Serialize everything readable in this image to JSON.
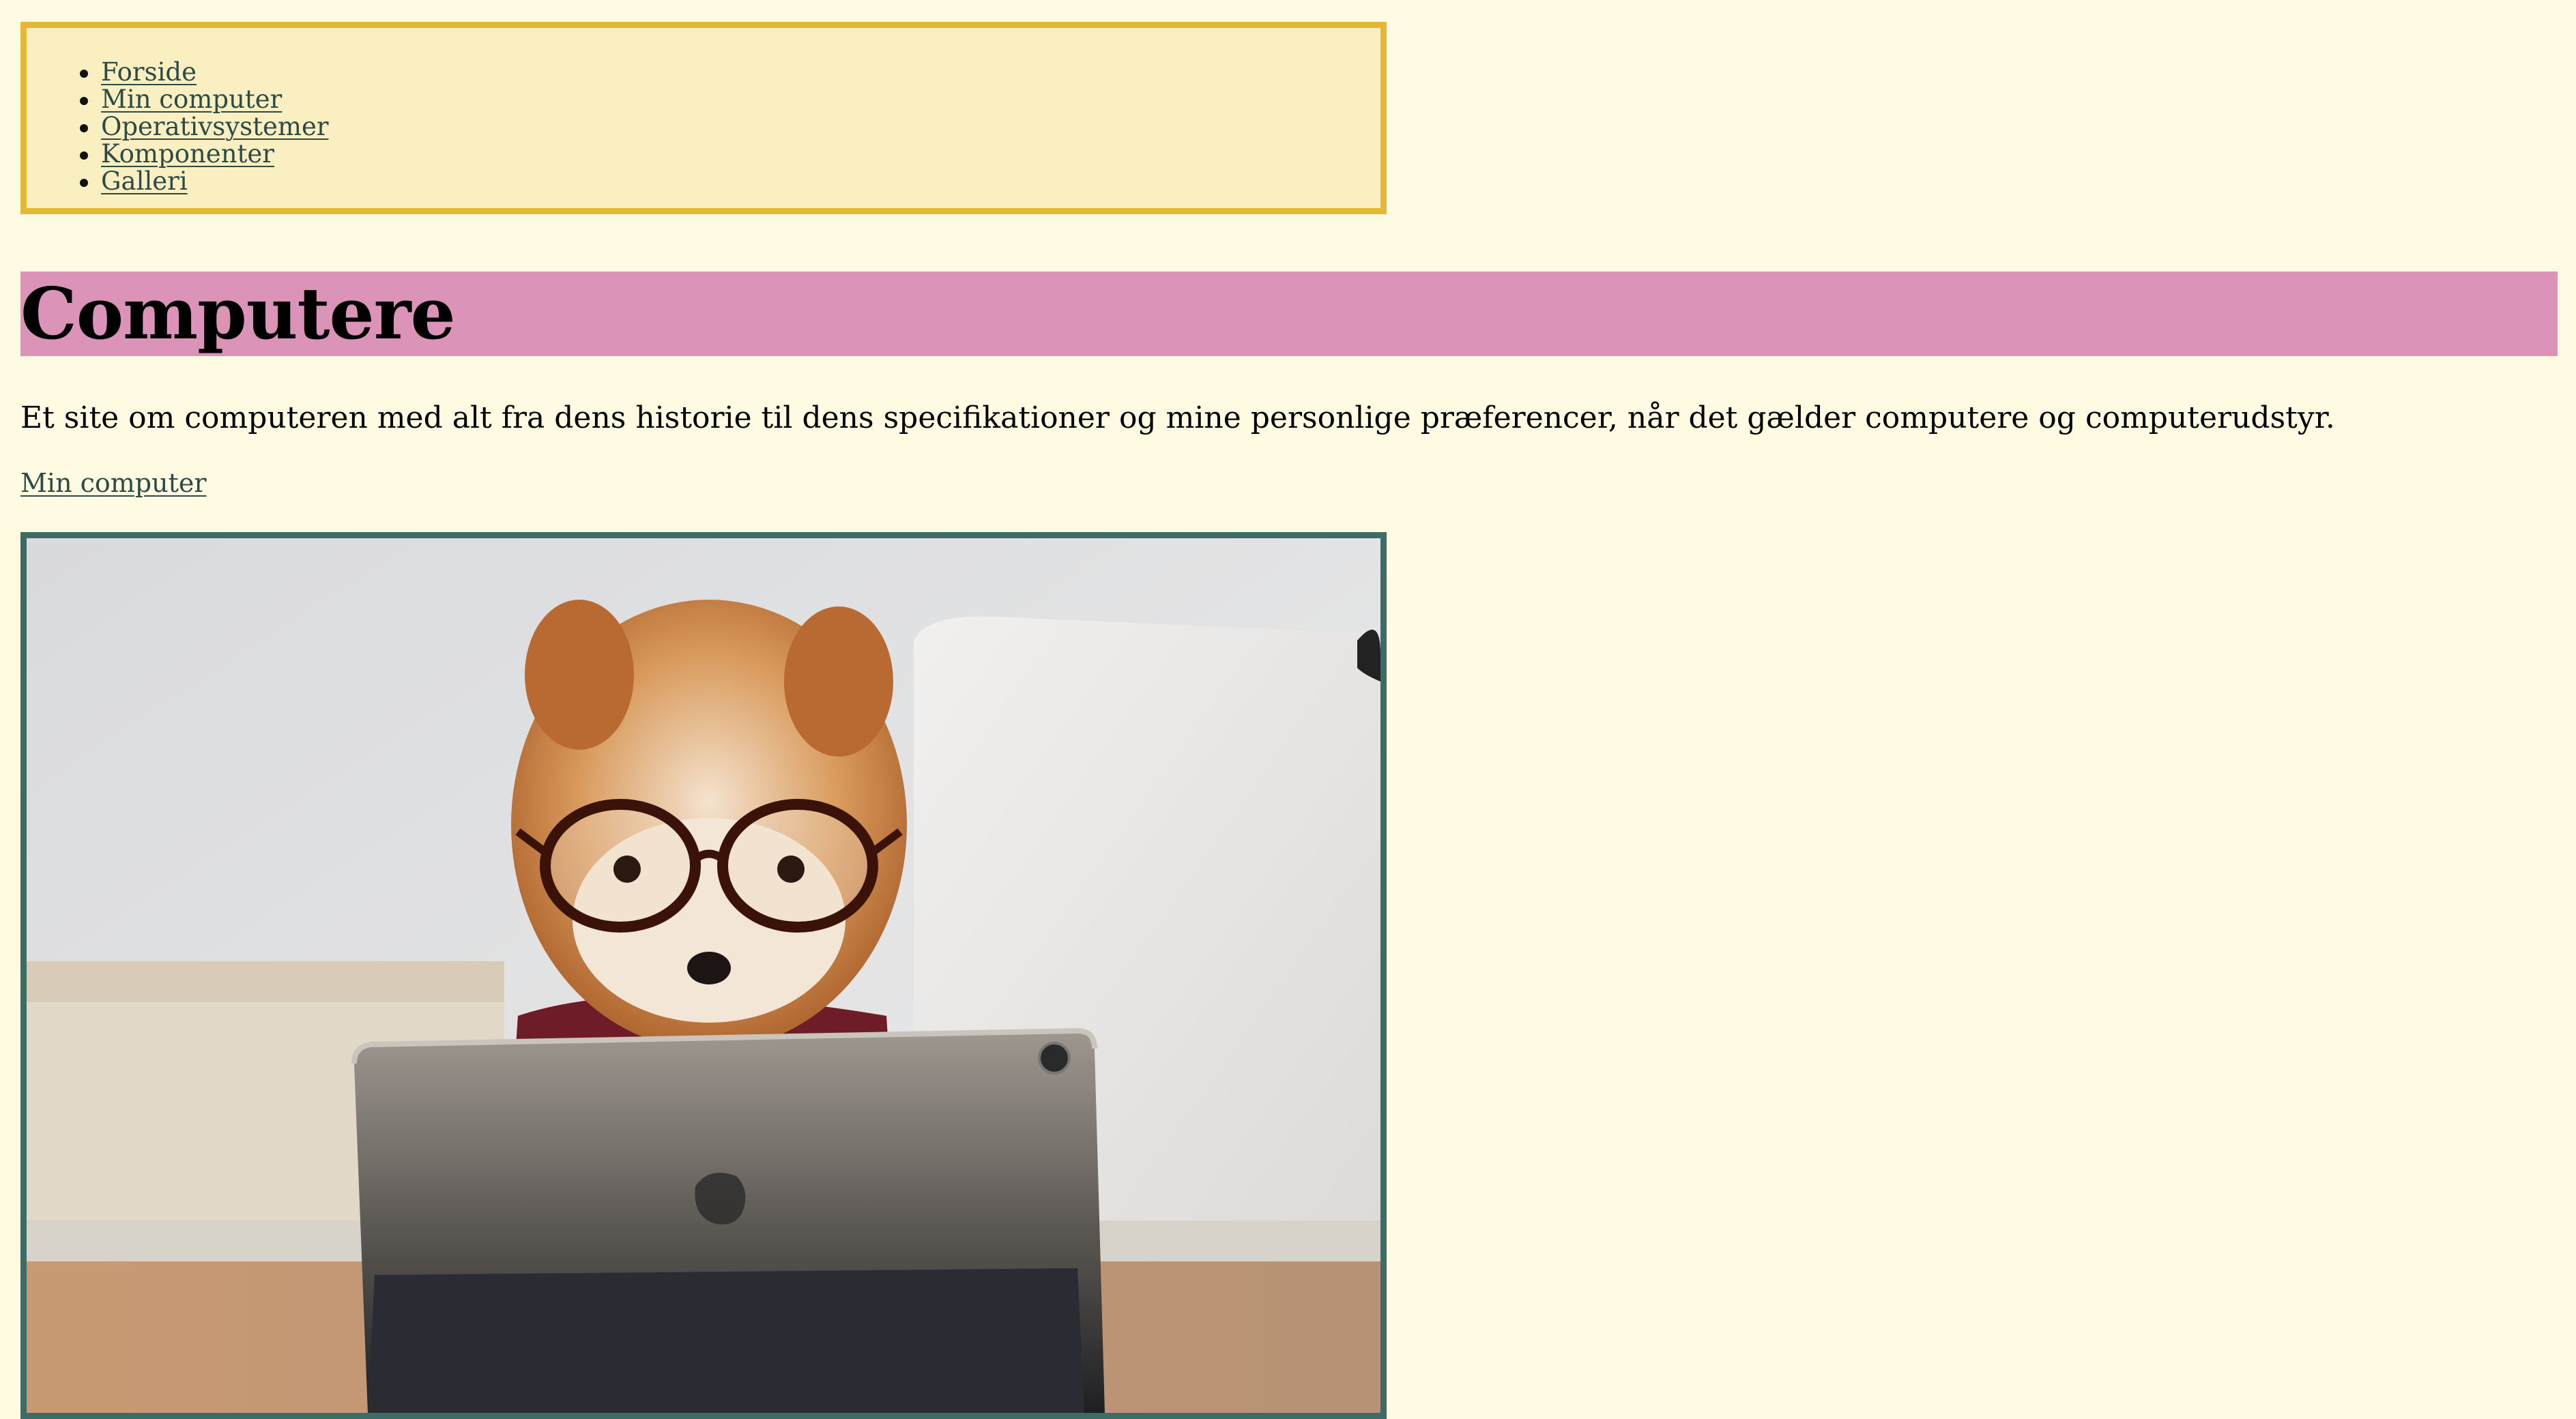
{
  "nav": {
    "items": [
      {
        "label": "Forside"
      },
      {
        "label": "Min computer"
      },
      {
        "label": "Operativsystemer"
      },
      {
        "label": "Komponenter"
      },
      {
        "label": "Galleri"
      }
    ]
  },
  "header": {
    "title": "Computere"
  },
  "main": {
    "intro": "Et site om computeren med alt fra dens historie til dens specifikationer og mine personlige præferencer, når det gælder computere og computerudstyr.",
    "link_label": "Min computer",
    "image_subject": "pomeranian-dog-with-glasses-looking-at-tablet"
  },
  "colors": {
    "background": "#fffbe3",
    "nav_border": "#e6b735",
    "nav_background": "#faefc0",
    "title_band": "#db94b8",
    "link": "#2d4a46",
    "image_border": "#3d6b66"
  }
}
